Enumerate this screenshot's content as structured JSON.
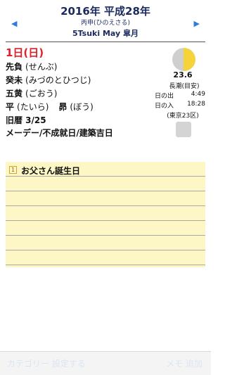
{
  "header": {
    "prev_arrow": "◀",
    "next_arrow": "▶",
    "year_title": "2016年 平成28年",
    "kanshi": "丙申(ひのえさる)",
    "month_line": "5Tsuki May 皐月"
  },
  "day": {
    "title": "1日(日)",
    "rokuyo": {
      "name": "先負",
      "reading": "(せんぶ)"
    },
    "eto": {
      "name": "癸未",
      "reading": "(みづのとひつじ)"
    },
    "kyusei": {
      "name": "五黄",
      "reading": "(ごおう)"
    },
    "choku": {
      "name": "平",
      "reading": "(たいら)"
    },
    "shuku": {
      "name": "昴",
      "reading": "(ぼう)"
    },
    "kyureki": "旧暦 3/25",
    "events": "メーデー/不成就日/建築吉日"
  },
  "moon": {
    "phase_icon": "half-moon-icon",
    "lit_fraction": 0.5,
    "age": "23.6",
    "tide": "長潮(目安)",
    "sunrise_label": "日の出",
    "sunrise": "4:49",
    "sunset_label": "日の入",
    "sunset": "18:28",
    "area": "(東京23区)"
  },
  "memo": {
    "badge": "1",
    "text": "お父さん誕生日"
  },
  "toolbar": {
    "left_label": "カテゴリー 設定する",
    "right_label": "メモ 追加"
  },
  "colors": {
    "accent": "#2f7be0",
    "title_navy": "#1a2a5e",
    "day_red": "#e0202a",
    "moon_yellow": "#f5d43a",
    "note_yellow": "#fcf7c4"
  }
}
